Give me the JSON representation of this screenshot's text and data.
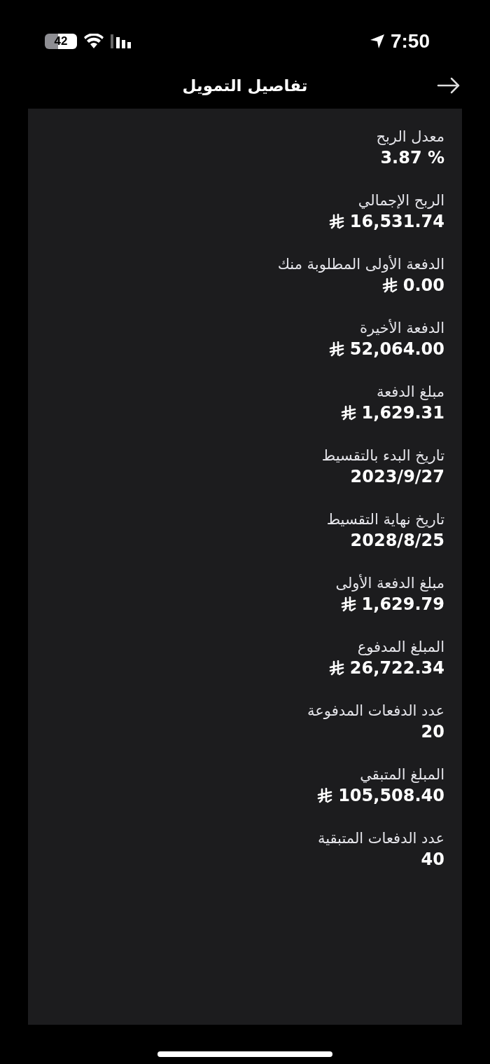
{
  "status_bar": {
    "battery": "42",
    "time": "7:50"
  },
  "header": {
    "title": "تفاصيل التمويل"
  },
  "details": [
    {
      "label": "معدل الربح",
      "value": "3.87 %",
      "kind": "plain"
    },
    {
      "label": "الربح الإجمالي",
      "value": "16,531.74",
      "kind": "money"
    },
    {
      "label": "الدفعة الأولى المطلوبة منك",
      "value": "0.00",
      "kind": "money"
    },
    {
      "label": "الدفعة الأخيرة",
      "value": "52,064.00",
      "kind": "money"
    },
    {
      "label": "مبلغ الدفعة",
      "value": "1,629.31",
      "kind": "money"
    },
    {
      "label": "تاريخ البدء بالتقسيط",
      "value": "2023/9/27",
      "kind": "plain"
    },
    {
      "label": "تاريخ نهاية التقسيط",
      "value": "2028/8/25",
      "kind": "plain"
    },
    {
      "label": "مبلغ الدفعة الأولى",
      "value": "1,629.79",
      "kind": "money"
    },
    {
      "label": "المبلغ المدفوع",
      "value": "26,722.34",
      "kind": "money"
    },
    {
      "label": "عدد الدفعات المدفوعة",
      "value": "20",
      "kind": "plain"
    },
    {
      "label": "المبلغ المتبقي",
      "value": "105,508.40",
      "kind": "money"
    },
    {
      "label": "عدد الدفعات المتبقية",
      "value": "40",
      "kind": "plain"
    }
  ]
}
